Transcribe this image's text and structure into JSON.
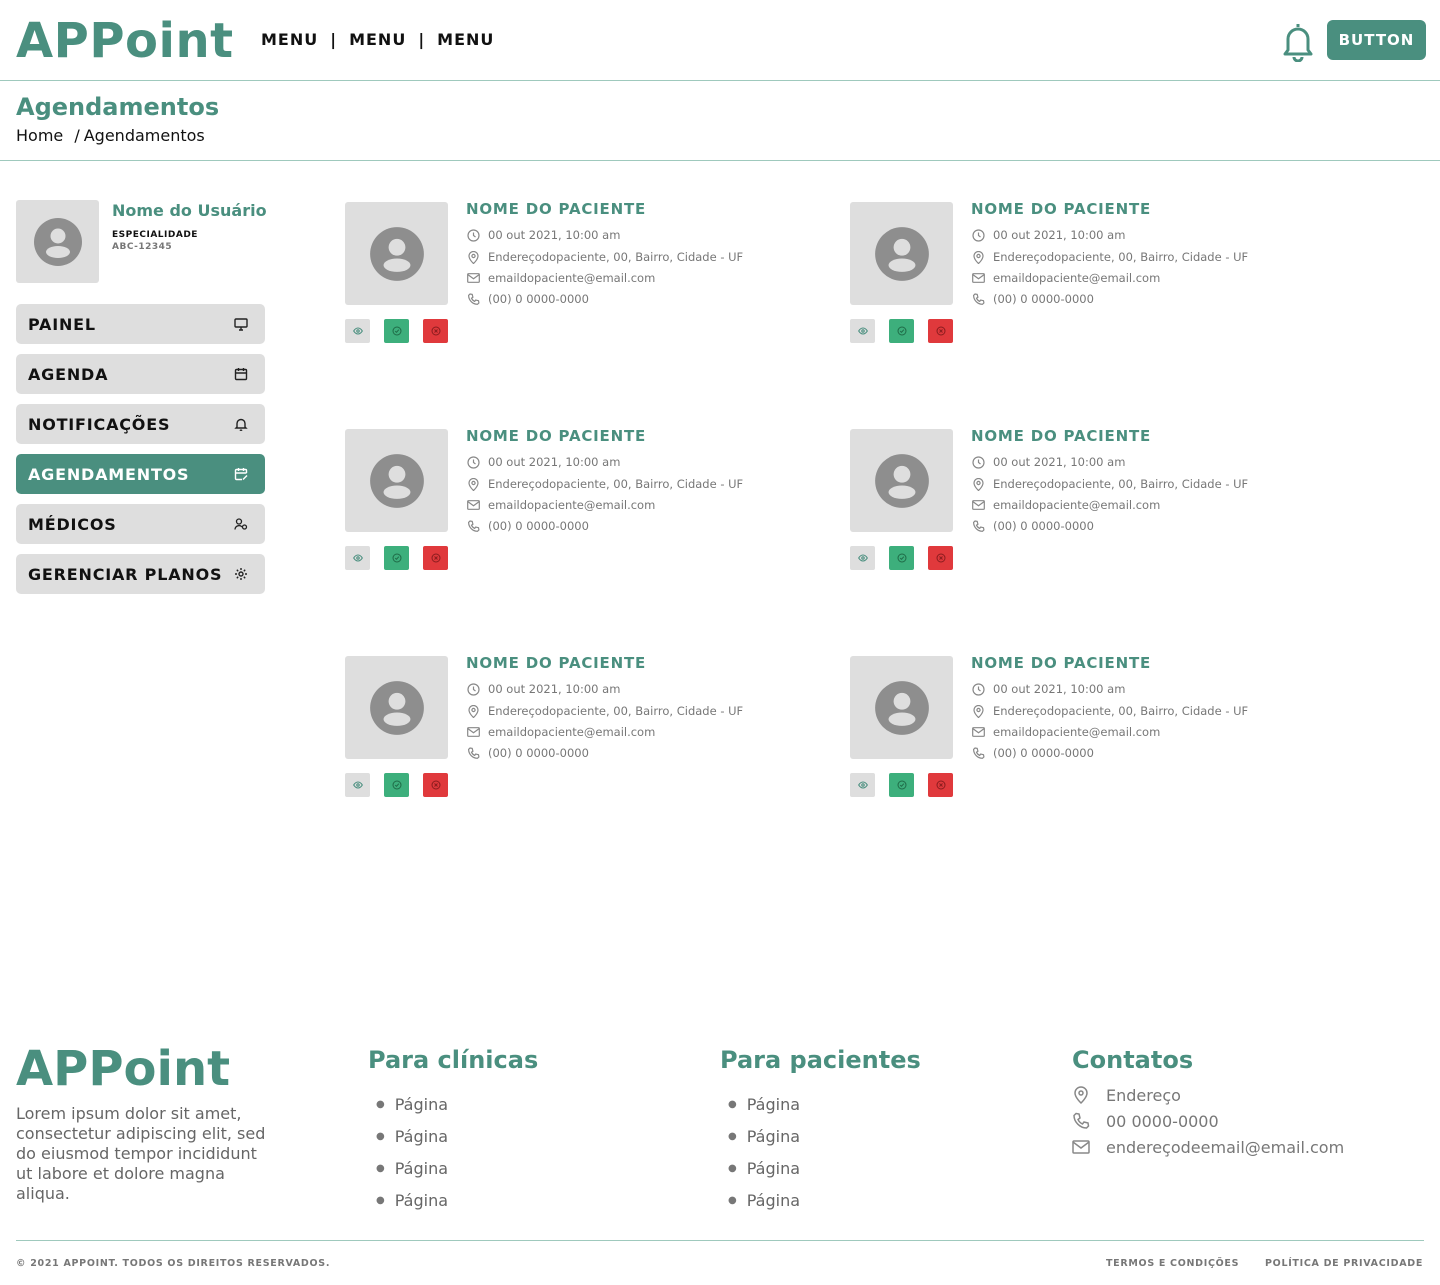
{
  "header": {
    "logo": "APPoint",
    "menu": [
      "MENU",
      "MENU",
      "MENU"
    ],
    "menu_separator": "|",
    "button_label": "BUTTON",
    "bell_icon": "bell-icon"
  },
  "page": {
    "title": "Agendamentos",
    "breadcrumb": {
      "home": "Home",
      "separator": "/",
      "current": "Agendamentos"
    }
  },
  "user": {
    "name": "Nome do Usuário",
    "specialty": "ESPECIALIDADE",
    "code": "ABC-12345",
    "avatar_icon": "user-avatar-icon"
  },
  "sidebar": {
    "items": [
      {
        "label": "PAINEL",
        "icon": "monitor-icon",
        "active": false
      },
      {
        "label": "AGENDA",
        "icon": "calendar-icon",
        "active": false
      },
      {
        "label": "NOTIFICAÇÕES",
        "icon": "bell-icon",
        "active": false
      },
      {
        "label": "AGENDAMENTOS",
        "icon": "calendar-edit-icon",
        "active": true
      },
      {
        "label": "MÉDICOS",
        "icon": "users-icon",
        "active": false
      },
      {
        "label": "GERENCIAR PLANOS",
        "icon": "gear-icon",
        "active": false
      }
    ]
  },
  "appointments": [
    {
      "name": "NOME DO PACIENTE",
      "datetime": "00 out 2021, 10:00 am",
      "address": "Endereçodopaciente, 00, Bairro, Cidade - UF",
      "email": "emaildopaciente@email.com",
      "phone": "(00) 0 0000-0000"
    },
    {
      "name": "NOME DO PACIENTE",
      "datetime": "00 out 2021, 10:00 am",
      "address": "Endereçodopaciente, 00, Bairro, Cidade - UF",
      "email": "emaildopaciente@email.com",
      "phone": "(00) 0 0000-0000"
    },
    {
      "name": "NOME DO PACIENTE",
      "datetime": "00 out 2021, 10:00 am",
      "address": "Endereçodopaciente, 00, Bairro, Cidade - UF",
      "email": "emaildopaciente@email.com",
      "phone": "(00) 0 0000-0000"
    },
    {
      "name": "NOME DO PACIENTE",
      "datetime": "00 out 2021, 10:00 am",
      "address": "Endereçodopaciente, 00, Bairro, Cidade - UF",
      "email": "emaildopaciente@email.com",
      "phone": "(00) 0 0000-0000"
    },
    {
      "name": "NOME DO PACIENTE",
      "datetime": "00 out 2021, 10:00 am",
      "address": "Endereçodopaciente, 00, Bairro, Cidade - UF",
      "email": "emaildopaciente@email.com",
      "phone": "(00) 0 0000-0000"
    },
    {
      "name": "NOME DO PACIENTE",
      "datetime": "00 out 2021, 10:00 am",
      "address": "Endereçodopaciente, 00, Bairro, Cidade - UF",
      "email": "emaildopaciente@email.com",
      "phone": "(00) 0 0000-0000"
    }
  ],
  "card_actions": {
    "view_icon": "eye-icon",
    "confirm_icon": "check-circle-icon",
    "cancel_icon": "x-circle-icon"
  },
  "colors": {
    "brand": "#4a8f7f",
    "confirm": "#3daf7c",
    "cancel": "#e0393c",
    "neutral": "#dedede"
  },
  "footer": {
    "logo": "APPoint",
    "description": "Lorem ipsum dolor sit amet, consectetur adipiscing elit, sed do eiusmod tempor incididunt ut labore et dolore magna aliqua.",
    "clinics": {
      "title": "Para clínicas",
      "links": [
        "Página",
        "Página",
        "Página",
        "Página"
      ]
    },
    "patients": {
      "title": "Para pacientes",
      "links": [
        "Página",
        "Página",
        "Página",
        "Página"
      ]
    },
    "contacts": {
      "title": "Contatos",
      "address": "Endereço",
      "phone": "00 0000-0000",
      "email": "endereçodeemail@email.com"
    },
    "copyright": "© 2021 APPOINT. TODOS OS DIREITOS RESERVADOS.",
    "terms": "TERMOS E CONDIÇÕES",
    "privacy": "POLÍTICA DE PRIVACIDADE"
  }
}
